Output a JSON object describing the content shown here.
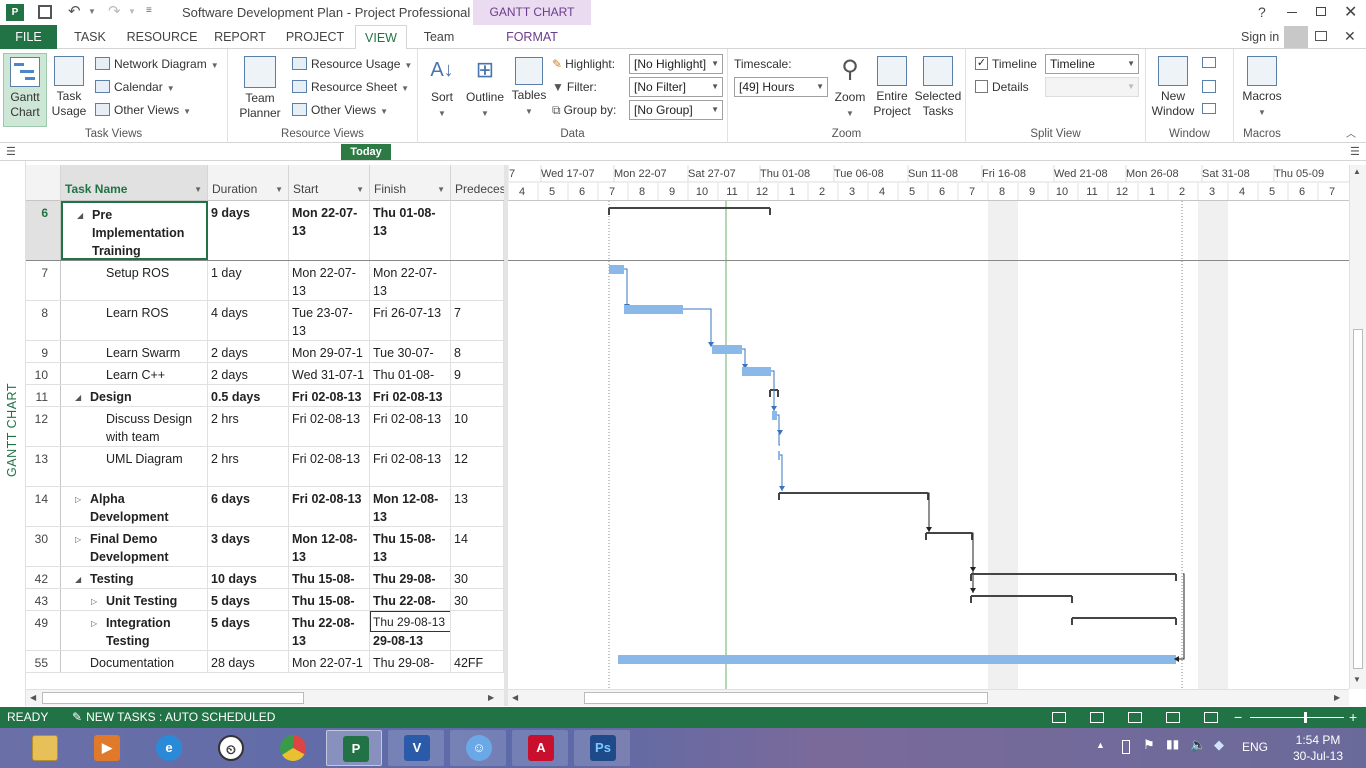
{
  "window": {
    "title": "Software Development Plan - Project Professional",
    "contextual_tab_group": "GANTT CHART TOOLS",
    "signin": "Sign in",
    "help": "?"
  },
  "tabs": [
    "FILE",
    "TASK",
    "RESOURCE",
    "REPORT",
    "PROJECT",
    "VIEW",
    "Team",
    "FORMAT"
  ],
  "ribbon": {
    "task_views": {
      "label": "Task Views",
      "gantt_chart": "Gantt Chart",
      "task_usage": "Task Usage",
      "network_diagram": "Network Diagram",
      "calendar": "Calendar",
      "other_views": "Other Views"
    },
    "resource_views": {
      "label": "Resource Views",
      "team_planner": "Team Planner",
      "resource_usage": "Resource Usage",
      "resource_sheet": "Resource Sheet",
      "other_views": "Other Views"
    },
    "data": {
      "label": "Data",
      "sort": "Sort",
      "outline": "Outline",
      "tables": "Tables",
      "highlight_label": "Highlight:",
      "highlight_value": "[No Highlight]",
      "filter_label": "Filter:",
      "filter_value": "[No Filter]",
      "groupby_label": "Group by:",
      "groupby_value": "[No Group]"
    },
    "zoom": {
      "label": "Zoom",
      "timescale_label": "Timescale:",
      "timescale_value": "[49] Hours",
      "zoom": "Zoom",
      "entire_project": "Entire Project",
      "selected_tasks": "Selected Tasks"
    },
    "split_view": {
      "label": "Split View",
      "timeline_label": "Timeline",
      "timeline_checked": true,
      "timeline_value": "Timeline",
      "details_label": "Details",
      "details_checked": false
    },
    "window": {
      "label": "Window",
      "new_window": "New Window"
    },
    "macros": {
      "label": "Macros",
      "macros": "Macros"
    }
  },
  "today_label": "Today",
  "view_bar_label": "GANTT CHART",
  "columns": [
    "Task Name",
    "Duration",
    "Start",
    "Finish",
    "Predeces"
  ],
  "timescale": {
    "top": [
      "7",
      "Wed 17-07",
      "Mon 22-07",
      "Sat 27-07",
      "Thu 01-08",
      "Tue 06-08",
      "Sun 11-08",
      "Fri 16-08",
      "Wed 21-08",
      "Mon 26-08",
      "Sat 31-08",
      "Thu 05-09"
    ],
    "bottom": [
      "4",
      "5",
      "6",
      "7",
      "8",
      "9",
      "10",
      "11",
      "12",
      "1",
      "2",
      "3",
      "4",
      "5",
      "6",
      "7",
      "8",
      "9",
      "10",
      "11",
      "12",
      "1",
      "2",
      "3",
      "4",
      "5",
      "6",
      "7"
    ]
  },
  "rows": [
    {
      "id": "6",
      "name": "Pre Implementation Training",
      "duration": "9 days",
      "start": "Mon 22-07-13",
      "finish": "Thu 01-08-13",
      "pred": "",
      "summary": true,
      "collapsed": false,
      "indent": 1
    },
    {
      "id": "7",
      "name": "Setup ROS",
      "duration": "1 day",
      "start": "Mon 22-07-13",
      "finish": "Mon 22-07-13",
      "pred": "",
      "summary": false,
      "indent": 2
    },
    {
      "id": "8",
      "name": "Learn ROS",
      "duration": "4 days",
      "start": "Tue 23-07-13",
      "finish": "Fri 26-07-13",
      "pred": "7",
      "summary": false,
      "indent": 2
    },
    {
      "id": "9",
      "name": "Learn Swarm",
      "duration": "2 days",
      "start": "Mon 29-07-1",
      "finish": "Tue 30-07-13",
      "pred": "8",
      "summary": false,
      "indent": 2
    },
    {
      "id": "10",
      "name": "Learn C++",
      "duration": "2 days",
      "start": "Wed 31-07-1",
      "finish": "Thu 01-08-13",
      "pred": "9",
      "summary": false,
      "indent": 2
    },
    {
      "id": "11",
      "name": "Design",
      "duration": "0.5 days",
      "start": "Fri 02-08-13",
      "finish": "Fri 02-08-13",
      "pred": "",
      "summary": true,
      "collapsed": false,
      "indent": 1
    },
    {
      "id": "12",
      "name": "Discuss Design with team",
      "duration": "2 hrs",
      "start": "Fri 02-08-13",
      "finish": "Fri 02-08-13",
      "pred": "10",
      "summary": false,
      "indent": 2
    },
    {
      "id": "13",
      "name": "UML Diagram",
      "duration": "2 hrs",
      "start": "Fri 02-08-13",
      "finish": "Fri 02-08-13",
      "pred": "12",
      "summary": false,
      "indent": 2
    },
    {
      "id": "14",
      "name": "Alpha Development",
      "duration": "6 days",
      "start": "Fri 02-08-13",
      "finish": "Mon 12-08-13",
      "pred": "13",
      "summary": true,
      "collapsed": true,
      "indent": 1
    },
    {
      "id": "30",
      "name": "Final Demo Development",
      "duration": "3 days",
      "start": "Mon 12-08-13",
      "finish": "Thu 15-08-13",
      "pred": "14",
      "summary": true,
      "collapsed": true,
      "indent": 1
    },
    {
      "id": "42",
      "name": "Testing",
      "duration": "10 days",
      "start": "Thu 15-08-13",
      "finish": "Thu 29-08-13",
      "pred": "30",
      "summary": true,
      "collapsed": false,
      "indent": 1
    },
    {
      "id": "43",
      "name": "Unit Testing",
      "duration": "5 days",
      "start": "Thu 15-08-13",
      "finish": "Thu 22-08-13",
      "pred": "30",
      "summary": true,
      "collapsed": true,
      "indent": 2
    },
    {
      "id": "49",
      "name": "Integration Testing",
      "duration": "5 days",
      "start": "Thu 22-08-13",
      "finish": "29-08-13",
      "finish_edit": "Thu 29-08-13",
      "pred": "",
      "summary": true,
      "collapsed": true,
      "indent": 2
    },
    {
      "id": "55",
      "name": "Documentation",
      "duration": "28 days",
      "start": "Mon 22-07-1",
      "finish": "Thu 29-08-13",
      "pred": "42FF",
      "summary": false,
      "indent": 1
    }
  ],
  "status": {
    "ready": "READY",
    "new_tasks": "NEW TASKS : AUTO SCHEDULED"
  },
  "taskbar": {
    "apps": [
      "file-explorer",
      "media-player",
      "internet-explorer",
      "clock",
      "chrome",
      "project",
      "visio",
      "finder",
      "acrobat",
      "photoshop"
    ],
    "lang": "ENG",
    "time": "1:54 PM",
    "date": "30-Jul-13"
  }
}
